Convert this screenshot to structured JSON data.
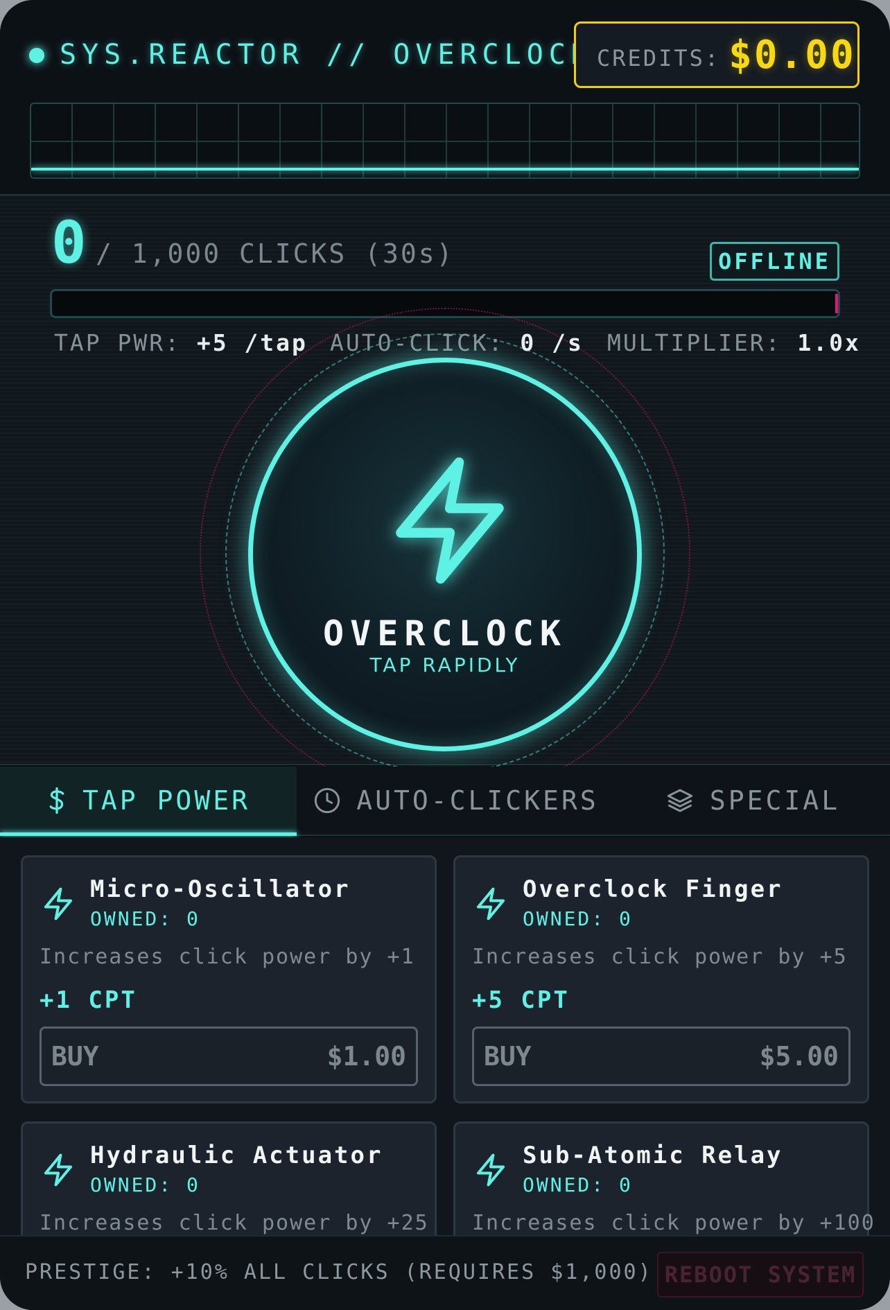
{
  "header": {
    "title": "SYS.REACTOR // OVERCLOCK",
    "credits_label": "CREDITS:",
    "credits_value": "$0.00"
  },
  "colors": {
    "accent": "#5ef2e4",
    "credits": "#f8d90f",
    "danger": "#e0177a"
  },
  "session": {
    "clicks": "0",
    "target": "/ 1,000 CLICKS (30s)",
    "status": "OFFLINE",
    "progress_fraction": 0
  },
  "stats": {
    "tap_label": "TAP PWR:",
    "tap_value": "+5 /tap",
    "auto_label": "AUTO-CLICK:",
    "auto_value": "0 /s",
    "mult_label": "MULTIPLIER:",
    "mult_value": "1.0x"
  },
  "core": {
    "label": "OVERCLOCK",
    "sub": "TAP RAPIDLY",
    "icon": "lightning-bolt-icon"
  },
  "tabs": [
    {
      "label": "TAP POWER",
      "icon": "dollar-icon",
      "active": true
    },
    {
      "label": "AUTO-CLICKERS",
      "icon": "clock-icon",
      "active": false
    },
    {
      "label": "SPECIAL",
      "icon": "layers-icon",
      "active": false
    }
  ],
  "upgrades": [
    {
      "name": "Micro-Oscillator",
      "owned": "OWNED: 0",
      "desc": "Increases click power by +1",
      "cpt": "+1 CPT",
      "buy": "BUY",
      "price": "$1.00"
    },
    {
      "name": "Overclock Finger",
      "owned": "OWNED: 0",
      "desc": "Increases click power by +5",
      "cpt": "+5 CPT",
      "buy": "BUY",
      "price": "$5.00"
    },
    {
      "name": "Hydraulic Actuator",
      "owned": "OWNED: 0",
      "desc": "Increases click power by +25",
      "cpt": "",
      "buy": "",
      "price": ""
    },
    {
      "name": "Sub-Atomic Relay",
      "owned": "OWNED: 0",
      "desc": "Increases click power by +100",
      "cpt": "",
      "buy": "",
      "price": ""
    }
  ],
  "footer": {
    "prestige": "PRESTIGE: +10% ALL CLICKS (REQUIRES $1,000)",
    "reboot": "REBOOT SYSTEM"
  }
}
